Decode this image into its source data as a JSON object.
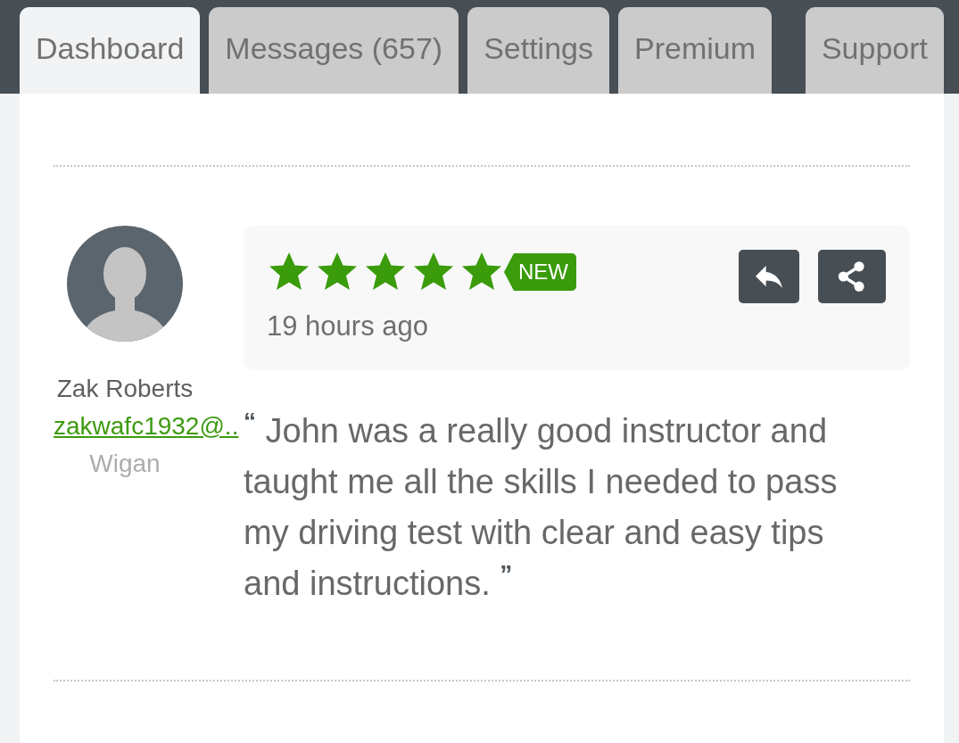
{
  "tabs": [
    {
      "label": "Dashboard",
      "selected": true
    },
    {
      "label": "Messages (657)",
      "selected": false
    },
    {
      "label": "Settings",
      "selected": false
    },
    {
      "label": "Premium",
      "selected": false
    },
    {
      "label": "Support",
      "selected": false
    }
  ],
  "reviews": [
    {
      "author": {
        "name": "Zak Roberts",
        "email": "zakwafc1932@..",
        "location": "Wigan"
      },
      "stars": 5,
      "badge": "NEW",
      "time": "19 hours ago",
      "text": "$^{“}$ John was a really good instructor and taught me all the skills I needed to pass my driving test with clear and easy tips and instructions. $^{”}$"
    }
  ]
}
